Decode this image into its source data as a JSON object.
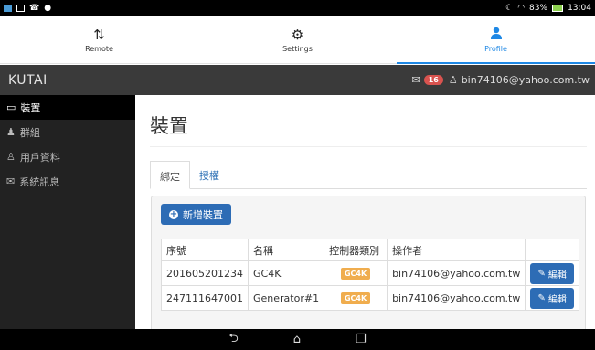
{
  "status_bar": {
    "battery": "83%",
    "time": "13:04"
  },
  "top_tabs": [
    {
      "label": "Remote",
      "icon": "sort-arrows-icon"
    },
    {
      "label": "Settings",
      "icon": "gear-icon"
    },
    {
      "label": "Profile",
      "icon": "user-icon"
    }
  ],
  "header": {
    "brand": "KUTAI",
    "message_count": "16",
    "user_email": "bin74106@yahoo.com.tw"
  },
  "sidebar": {
    "items": [
      {
        "label": "裝置",
        "icon": "monitor-icon"
      },
      {
        "label": "群組",
        "icon": "group-icon"
      },
      {
        "label": "用戶資料",
        "icon": "user-icon"
      },
      {
        "label": "系統訊息",
        "icon": "envelope-icon"
      }
    ]
  },
  "main": {
    "title": "裝置",
    "tabs": [
      {
        "label": "綁定"
      },
      {
        "label": "授權"
      }
    ],
    "add_button": "新增裝置",
    "table": {
      "headers": [
        "序號",
        "名稱",
        "控制器類別",
        "操作者",
        ""
      ],
      "rows": [
        {
          "serial": "201605201234",
          "name": "GC4K",
          "type": "GC4K",
          "operator": "bin74106@yahoo.com.tw",
          "action": "編輯"
        },
        {
          "serial": "247111647001",
          "name": "Generator#1",
          "type": "GC4K",
          "operator": "bin74106@yahoo.com.tw",
          "action": "編輯"
        }
      ]
    }
  },
  "colors": {
    "accent": "#1e88e5",
    "primary_button": "#2d6cb5",
    "badge": "#d9534f",
    "type_label": "#f0ad4e"
  }
}
